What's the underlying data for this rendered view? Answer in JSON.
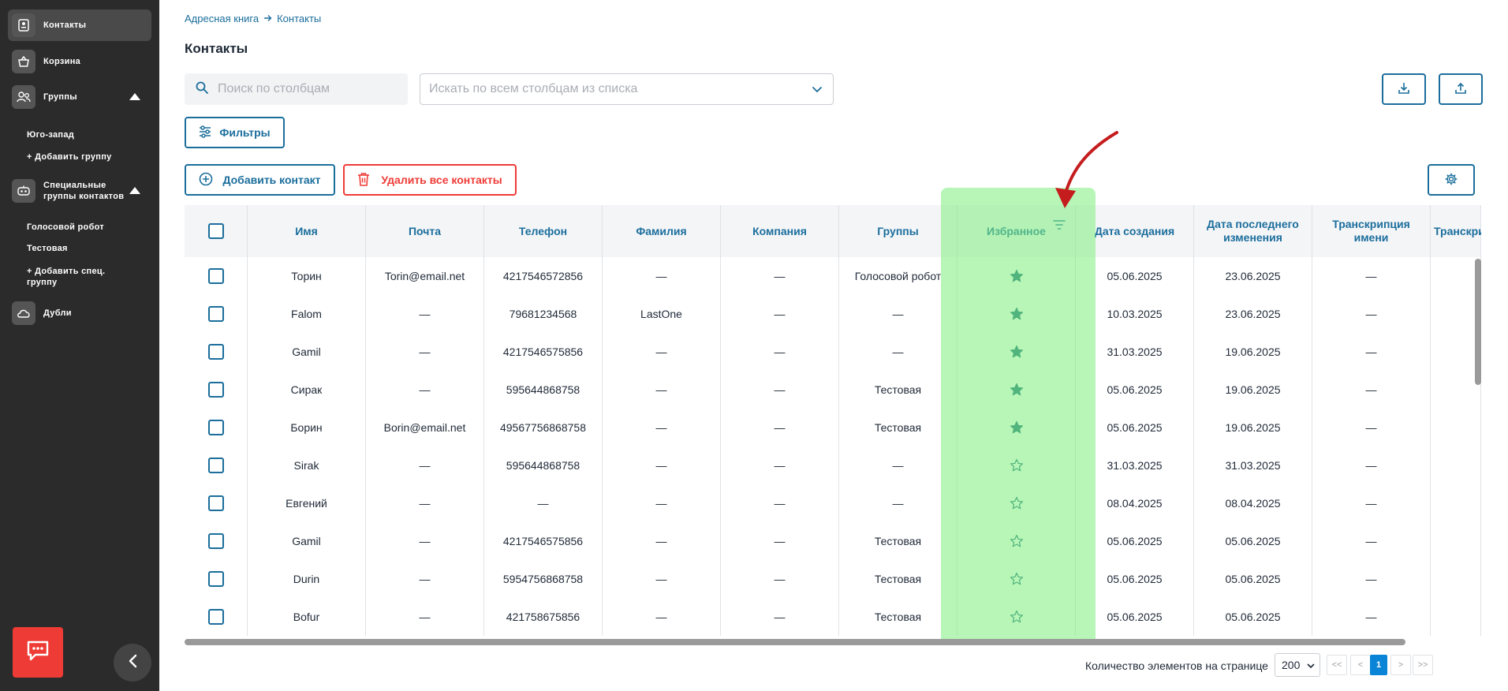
{
  "sidebar": {
    "nav": [
      {
        "label": "Контакты",
        "icon": "contact-card-icon"
      },
      {
        "label": "Корзина",
        "icon": "basket-icon"
      },
      {
        "label": "Группы",
        "icon": "users-icon"
      },
      {
        "label": "Специальные группы контактов",
        "icon": "robot-icon"
      },
      {
        "label": "Дубли",
        "icon": "cloud-icon"
      }
    ],
    "groups": [
      "Юго-запад",
      "+ Добавить группу"
    ],
    "special_groups": [
      "Голосовой робот",
      "Тестовая",
      "+ Добавить спец. группу"
    ]
  },
  "breadcrumb": {
    "items": [
      "Адресная книга",
      "Контакты"
    ]
  },
  "page": {
    "title": "Контакты"
  },
  "search": {
    "placeholder": "Поиск по столбцам"
  },
  "column_select": {
    "placeholder": "Искать по всем столбцам из списка"
  },
  "toolbar": {
    "filters_label": "Фильтры",
    "add_contact_label": "Добавить контакт",
    "delete_all_label": "Удалить все контакты"
  },
  "table": {
    "columns": [
      "Имя",
      "Почта",
      "Телефон",
      "Фамилия",
      "Компания",
      "Группы",
      "Избранное",
      "Дата создания",
      "Дата последнего изменения",
      "Транскрипция имени",
      "Транскрипц"
    ],
    "rows": [
      {
        "name": "Торин",
        "email": "Torin@email.net",
        "phone": "4217546572856",
        "surname": "—",
        "company": "—",
        "groups": "Голосовой робот",
        "favorite": true,
        "created": "05.06.2025",
        "modified": "23.06.2025",
        "transcription": "—"
      },
      {
        "name": "Falom",
        "email": "—",
        "phone": "79681234568",
        "surname": "LastOne",
        "company": "—",
        "groups": "—",
        "favorite": true,
        "created": "10.03.2025",
        "modified": "23.06.2025",
        "transcription": "—"
      },
      {
        "name": "Gamil",
        "email": "—",
        "phone": "4217546575856",
        "surname": "—",
        "company": "—",
        "groups": "—",
        "favorite": true,
        "created": "31.03.2025",
        "modified": "19.06.2025",
        "transcription": "—"
      },
      {
        "name": "Сирак",
        "email": "—",
        "phone": "595644868758",
        "surname": "—",
        "company": "—",
        "groups": "Тестовая",
        "favorite": true,
        "created": "05.06.2025",
        "modified": "19.06.2025",
        "transcription": "—"
      },
      {
        "name": "Борин",
        "email": "Borin@email.net",
        "phone": "49567756868758",
        "surname": "—",
        "company": "—",
        "groups": "Тестовая",
        "favorite": true,
        "created": "05.06.2025",
        "modified": "19.06.2025",
        "transcription": "—"
      },
      {
        "name": "Sirak",
        "email": "—",
        "phone": "595644868758",
        "surname": "—",
        "company": "—",
        "groups": "—",
        "favorite": false,
        "created": "31.03.2025",
        "modified": "31.03.2025",
        "transcription": "—"
      },
      {
        "name": "Евгений",
        "email": "—",
        "phone": "—",
        "surname": "—",
        "company": "—",
        "groups": "—",
        "favorite": false,
        "created": "08.04.2025",
        "modified": "08.04.2025",
        "transcription": "—"
      },
      {
        "name": "Gamil",
        "email": "—",
        "phone": "4217546575856",
        "surname": "—",
        "company": "—",
        "groups": "Тестовая",
        "favorite": false,
        "created": "05.06.2025",
        "modified": "05.06.2025",
        "transcription": "—"
      },
      {
        "name": "Durin",
        "email": "—",
        "phone": "5954756868758",
        "surname": "—",
        "company": "—",
        "groups": "Тестовая",
        "favorite": false,
        "created": "05.06.2025",
        "modified": "05.06.2025",
        "transcription": "—"
      },
      {
        "name": "Bofur",
        "email": "—",
        "phone": "421758675856",
        "surname": "—",
        "company": "—",
        "groups": "Тестовая",
        "favorite": false,
        "created": "05.06.2025",
        "modified": "05.06.2025",
        "transcription": "—"
      }
    ]
  },
  "pagination": {
    "per_page_label": "Количество элементов на странице",
    "per_page_value": "200",
    "first": "<<",
    "prev": "<",
    "current": "1",
    "next": ">",
    "last": ">>"
  },
  "colors": {
    "accent": "#1b6e9c",
    "danger": "#ef3b36",
    "star": "#1b6e7a",
    "highlight": "#7eef7e"
  }
}
